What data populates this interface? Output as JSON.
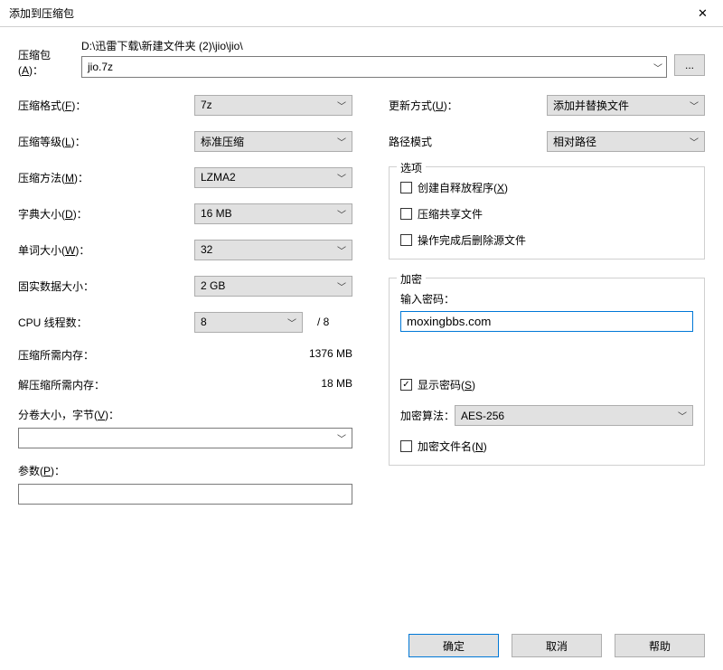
{
  "window": {
    "title": "添加到压缩包"
  },
  "archive": {
    "label": "压缩包",
    "label_hotkey": "A",
    "path": "D:\\迅雷下载\\新建文件夹 (2)\\jio\\jio\\",
    "filename": "jio.7z",
    "browse": "..."
  },
  "left": {
    "format": {
      "label": "压缩格式",
      "hotkey": "F",
      "value": "7z"
    },
    "level": {
      "label": "压缩等级",
      "hotkey": "L",
      "value": "标准压缩"
    },
    "method": {
      "label": "压缩方法",
      "hotkey": "M",
      "value": "LZMA2"
    },
    "dict": {
      "label": "字典大小",
      "hotkey": "D",
      "value": "16 MB"
    },
    "word": {
      "label": "单词大小",
      "hotkey": "W",
      "value": "32"
    },
    "solid": {
      "label": "固实数据大小：",
      "value": "2 GB"
    },
    "threads": {
      "label": "CPU 线程数：",
      "value": "8",
      "max": "/ 8"
    },
    "mem_compress": {
      "label": "压缩所需内存：",
      "value": "1376 MB"
    },
    "mem_decompress": {
      "label": "解压缩所需内存：",
      "value": "18 MB"
    },
    "split": {
      "label": "分卷大小，字节",
      "hotkey": "V"
    },
    "params": {
      "label": "参数",
      "hotkey": "P"
    }
  },
  "right": {
    "update": {
      "label": "更新方式",
      "hotkey": "U",
      "value": "添加并替换文件"
    },
    "pathmode": {
      "label": "路径模式",
      "value": "相对路径"
    },
    "options": {
      "legend": "选项",
      "sfx": {
        "label": "创建自释放程序",
        "hotkey": "X"
      },
      "shared": {
        "label": "压缩共享文件"
      },
      "delete": {
        "label": "操作完成后删除源文件"
      }
    },
    "encryption": {
      "legend": "加密",
      "pwd_label": "输入密码：",
      "pwd_value": "moxingbbs.com",
      "show_pwd": {
        "label": "显示密码",
        "hotkey": "S",
        "checked": true
      },
      "algo": {
        "label": "加密算法：",
        "value": "AES-256"
      },
      "enc_names": {
        "label": "加密文件名",
        "hotkey": "N"
      }
    }
  },
  "buttons": {
    "ok": "确定",
    "cancel": "取消",
    "help": "帮助"
  }
}
